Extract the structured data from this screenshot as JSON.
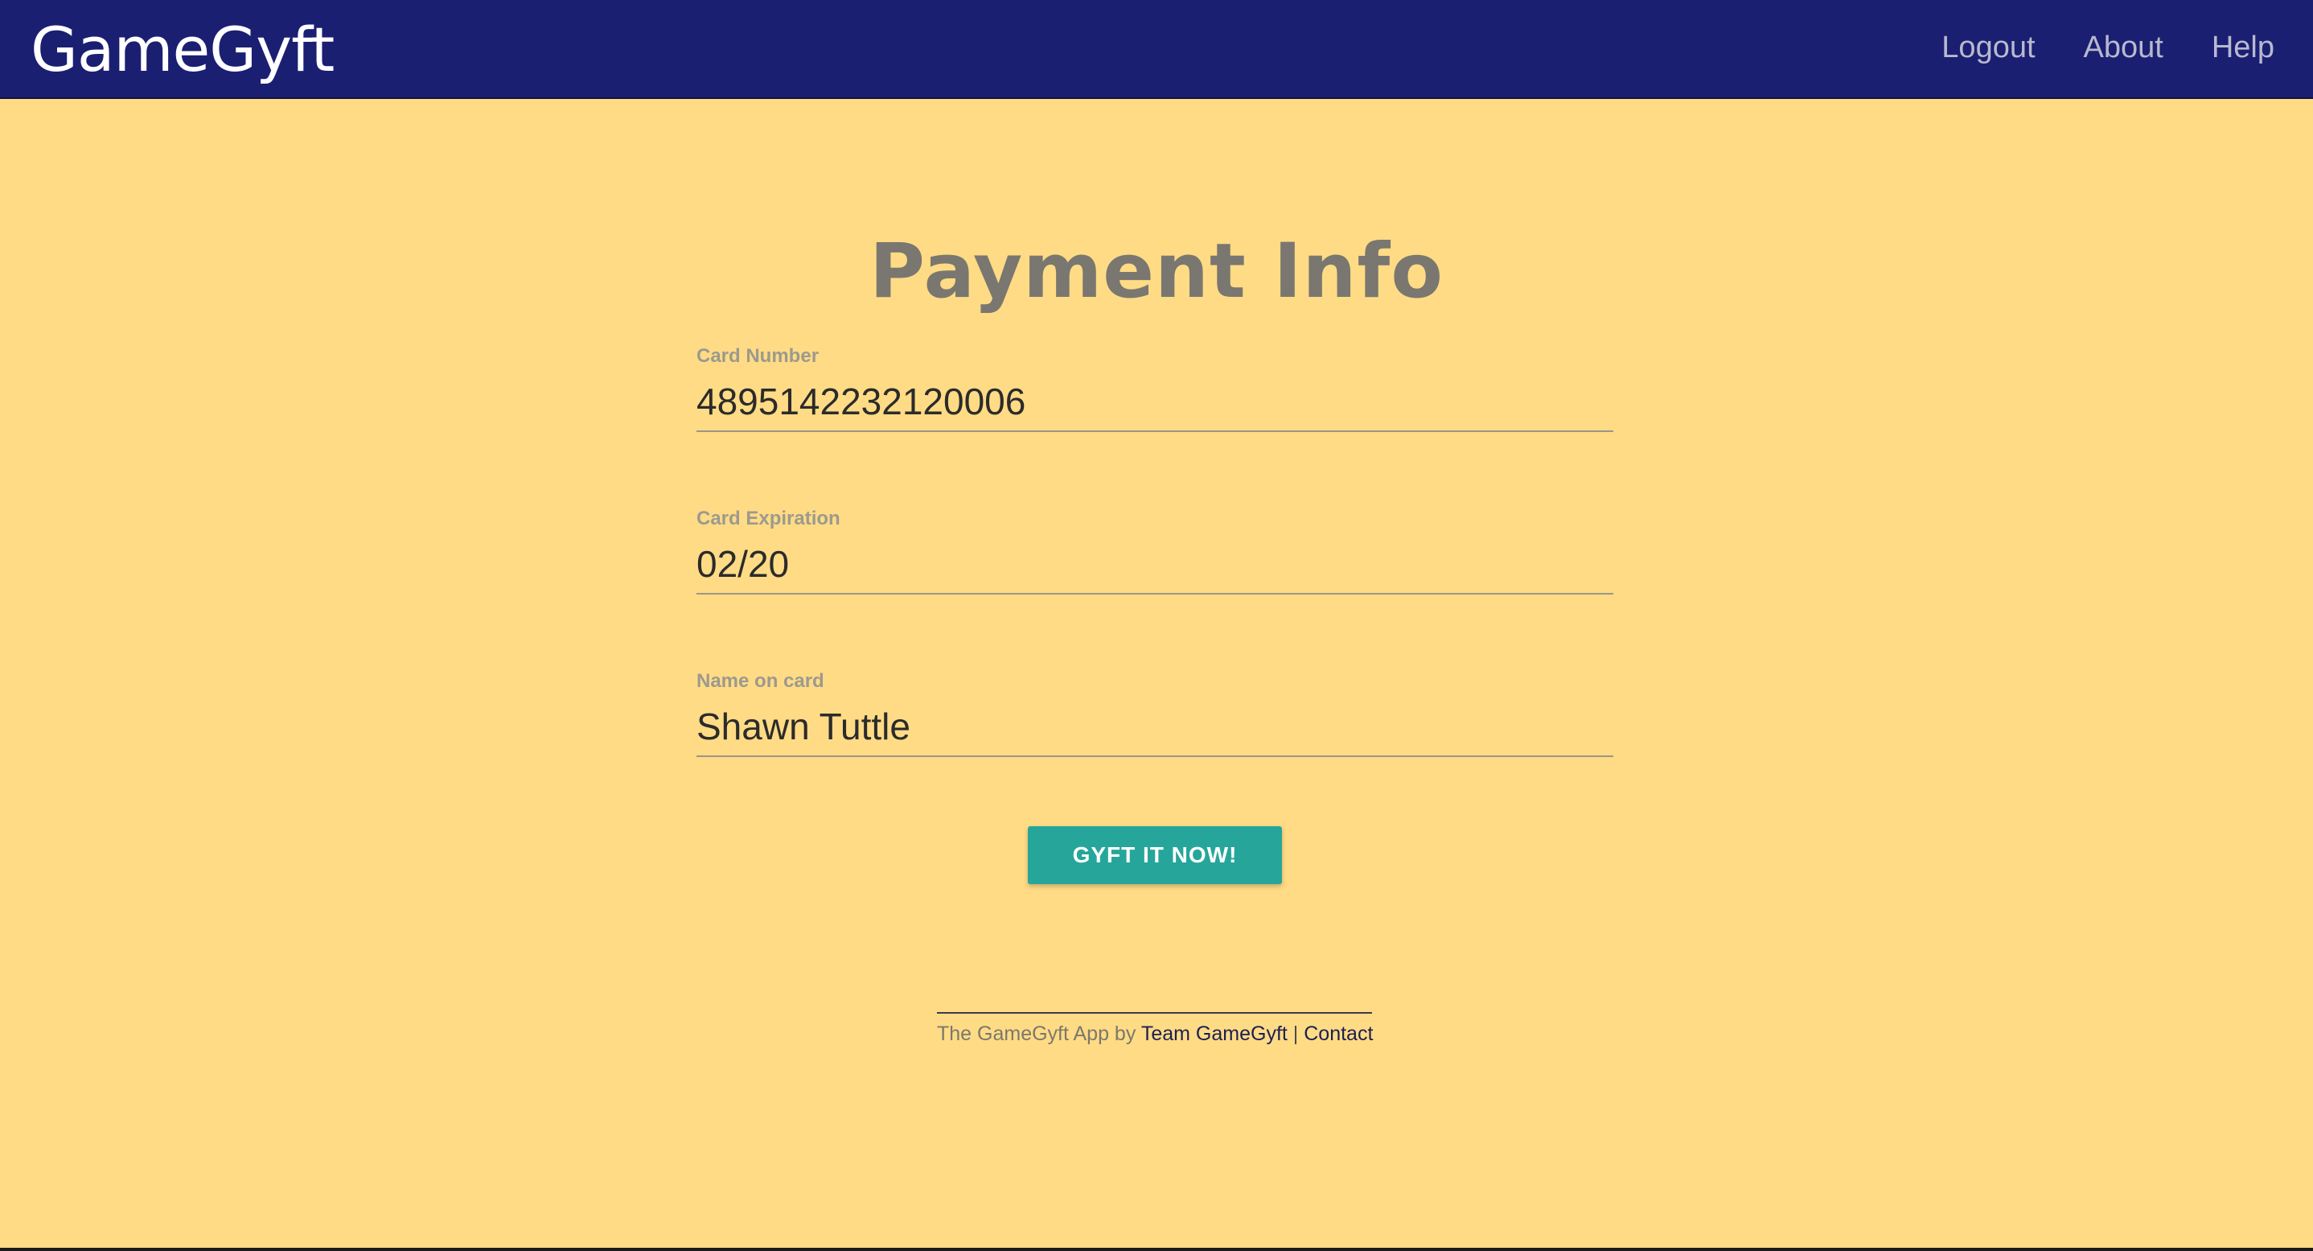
{
  "navbar": {
    "brand": "GameGyft",
    "links": [
      "Logout",
      "About",
      "Help"
    ]
  },
  "page": {
    "title": "Payment Info"
  },
  "form": {
    "card_number": {
      "label": "Card Number",
      "value": "4895142232120006"
    },
    "card_expiration": {
      "label": "Card Expiration",
      "value": "02/20"
    },
    "name_on_card": {
      "label": "Name on card",
      "value": "Shawn Tuttle"
    },
    "submit_label": "GYFT IT NOW!"
  },
  "footer": {
    "prefix": "The GameGyft App by",
    "team_link": "Team GameGyft",
    "separator": "|",
    "contact_link": "Contact"
  },
  "colors": {
    "navbar_bg": "#1b1f72",
    "page_bg": "#ffdb85",
    "button_bg": "#26a69a"
  }
}
